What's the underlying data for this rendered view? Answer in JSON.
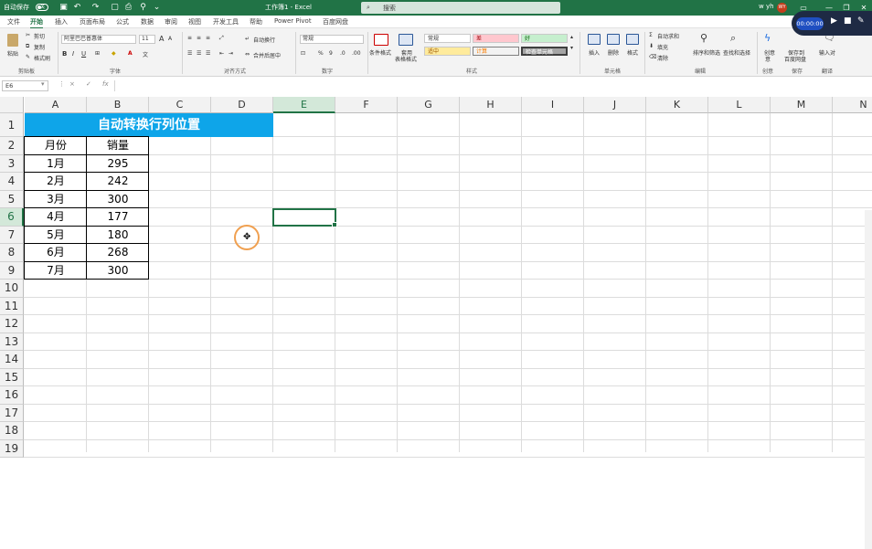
{
  "titlebar": {
    "autosave": "自动保存",
    "autosave_state": "关",
    "doc_title": "工作簿1 - Excel",
    "search_placeholder": "搜索",
    "user": "w yh",
    "avatar": "WY"
  },
  "menu": {
    "tabs": [
      "文件",
      "开始",
      "插入",
      "页面布局",
      "公式",
      "数据",
      "审阅",
      "视图",
      "开发工具",
      "帮助",
      "Power Pivot",
      "百度网盘"
    ],
    "active": "开始"
  },
  "ribbon": {
    "clipboard": {
      "paste": "粘贴",
      "cut": "剪切",
      "copy": "复制",
      "format_painter": "格式刷",
      "group": "剪贴板"
    },
    "font": {
      "name": "阿里巴巴普惠体",
      "size": "11",
      "bold": "B",
      "italic": "I",
      "underline": "U",
      "grow": "A",
      "shrink": "A",
      "group": "字体"
    },
    "alignment": {
      "wrap": "自动换行",
      "merge": "合并后居中",
      "group": "对齐方式"
    },
    "number": {
      "format": "常规",
      "percent": "%",
      "comma": "9",
      "group": "数字"
    },
    "styles": {
      "conditional": "条件格式",
      "table": "套用",
      "table2": "表格格式",
      "normal": "常规",
      "bad": "差",
      "good": "好",
      "neutral": "适中",
      "calc": "计算",
      "check": "检查单元格",
      "group": "样式"
    },
    "cells": {
      "insert": "插入",
      "delete": "删除",
      "format": "格式",
      "group": "单元格"
    },
    "editing": {
      "autosum": "自动求和",
      "fill": "填充",
      "clear": "清除",
      "sort": "排序和筛选",
      "find": "查找和选择",
      "group": "编辑"
    },
    "creative": {
      "label": "创意",
      "label2": "意",
      "group": "创意"
    },
    "save": {
      "label": "保存到",
      "label2": "百度网盘",
      "group": "保存"
    },
    "translate": {
      "label": "输入对",
      "group": "翻译"
    }
  },
  "recorder": {
    "time": "00:00:00"
  },
  "formula_bar": {
    "name_box": "E6",
    "fx": "fx",
    "cancel": "×",
    "enter": "✓",
    "content": ""
  },
  "grid": {
    "columns": [
      "A",
      "B",
      "C",
      "D",
      "E",
      "F",
      "G",
      "H",
      "I",
      "J",
      "K",
      "L",
      "M",
      "N"
    ],
    "selected_col": "E",
    "rows": [
      "1",
      "2",
      "3",
      "4",
      "5",
      "6",
      "7",
      "8",
      "9",
      "10",
      "11",
      "12",
      "13",
      "14",
      "15",
      "16",
      "17",
      "18",
      "19"
    ],
    "selected_row": "6",
    "title": "自动转换行列位置",
    "header": [
      "月份",
      "销量"
    ],
    "data": [
      [
        "1月",
        "295"
      ],
      [
        "2月",
        "242"
      ],
      [
        "3月",
        "300"
      ],
      [
        "4月",
        "177"
      ],
      [
        "5月",
        "180"
      ],
      [
        "6月",
        "268"
      ],
      [
        "7月",
        "300"
      ]
    ]
  },
  "colors": {
    "excel_green": "#217346",
    "title_fill": "#0ea5e9",
    "bad_fill": "#ffc7ce",
    "good_fill": "#c6efce",
    "neutral_fill": "#ffeb9c",
    "calc_fill": "#f2f2f2",
    "check_fill": "#a5a5a5"
  }
}
